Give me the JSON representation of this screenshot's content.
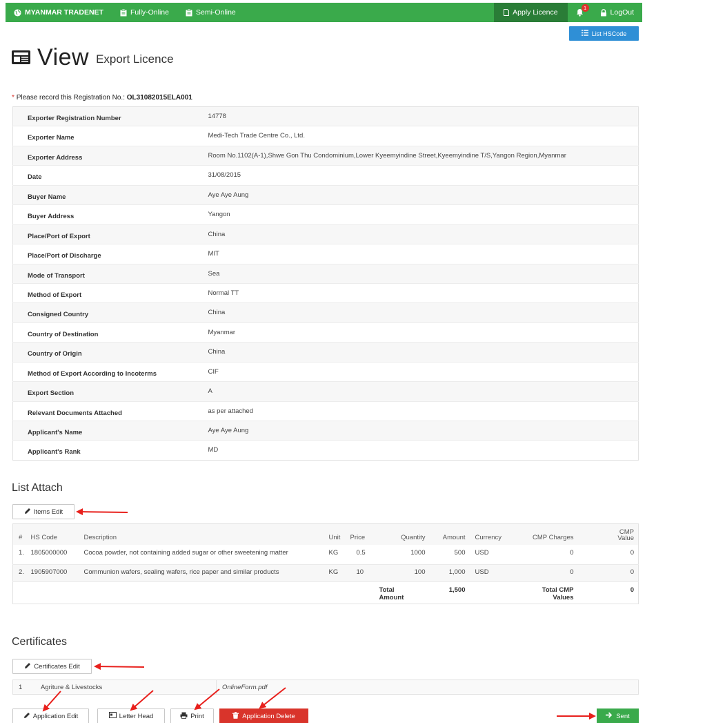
{
  "nav": {
    "brand": "MYANMAR TRADENET",
    "fully_online": "Fully-Online",
    "semi_online": "Semi-Online",
    "apply_licence": "Apply Licence",
    "notification_count": "1",
    "logout": "LogOut"
  },
  "list_hscode_button": "List HSCode",
  "title": {
    "main": "View",
    "sub": "Export Licence"
  },
  "registration": {
    "asterisk": "*",
    "prefix": "Please record this Registration No.:",
    "number": "OL31082015ELA001"
  },
  "details": [
    {
      "label": "Exporter Registration Number",
      "value": "14778"
    },
    {
      "label": "Exporter Name",
      "value": "Medi-Tech Trade Centre Co., Ltd."
    },
    {
      "label": "Exporter Address",
      "value": "Room No.1102(A-1),Shwe Gon Thu Condominium,Lower Kyeemyindine Street,Kyeemyindine T/S,Yangon Region,Myanmar"
    },
    {
      "label": "Date",
      "value": "31/08/2015"
    },
    {
      "label": "Buyer Name",
      "value": "Aye Aye Aung"
    },
    {
      "label": "Buyer Address",
      "value": "Yangon"
    },
    {
      "label": "Place/Port of Export",
      "value": "China"
    },
    {
      "label": "Place/Port of Discharge",
      "value": "MIT"
    },
    {
      "label": "Mode of Transport",
      "value": "Sea"
    },
    {
      "label": "Method of Export",
      "value": "Normal TT"
    },
    {
      "label": "Consigned Country",
      "value": "China"
    },
    {
      "label": "Country of Destination",
      "value": "Myanmar"
    },
    {
      "label": "Country of Origin",
      "value": "China"
    },
    {
      "label": "Method of Export According to Incoterms",
      "value": "CIF"
    },
    {
      "label": "Export Section",
      "value": "A"
    },
    {
      "label": "Relevant Documents Attached",
      "value": "as per attached"
    },
    {
      "label": "Applicant's Name",
      "value": "Aye Aye Aung"
    },
    {
      "label": "Applicant's Rank",
      "value": "MD"
    }
  ],
  "list_attach": {
    "heading": "List Attach",
    "edit_button": "Items Edit",
    "headers": {
      "num": "#",
      "hs_code": "HS Code",
      "description": "Description",
      "unit": "Unit",
      "price": "Price",
      "quantity": "Quantity",
      "amount": "Amount",
      "currency": "Currency",
      "cmp_charges": "CMP Charges",
      "cmp_value_1": "CMP",
      "cmp_value_2": "Value"
    },
    "rows": [
      {
        "num": "1.",
        "hs_code": "1805000000",
        "description": "Cocoa powder, not containing added sugar or other sweetening matter",
        "unit": "KG",
        "price": "0.5",
        "quantity": "1000",
        "amount": "500",
        "currency": "USD",
        "cmp_charges": "0",
        "cmp_value": "0"
      },
      {
        "num": "2.",
        "hs_code": "1905907000",
        "description": "Communion wafers, sealing wafers, rice paper and similar products",
        "unit": "KG",
        "price": "10",
        "quantity": "100",
        "amount": "1,000",
        "currency": "USD",
        "cmp_charges": "0",
        "cmp_value": "0"
      }
    ],
    "totals": {
      "amount_label_1": "Total",
      "amount_label_2": "Amount",
      "amount": "1,500",
      "cmp_label_1": "Total CMP",
      "cmp_label_2": "Values",
      "cmp": "0"
    }
  },
  "certificates": {
    "heading": "Certificates",
    "edit_button": "Certificates Edit",
    "row": {
      "num": "1",
      "name": "Agriture & Livestocks",
      "file": "OnlineForm.pdf"
    }
  },
  "actions": {
    "application_edit": "Application Edit",
    "letter_head": "Letter Head",
    "print": "Print",
    "application_delete": "Application Delete",
    "sent": "Sent"
  },
  "colors": {
    "nav_green": "#3aaa4b",
    "nav_active": "#2a7d37",
    "primary_blue": "#2f8fd6",
    "danger_red": "#d9342b",
    "annotation_red": "#e8201c"
  }
}
